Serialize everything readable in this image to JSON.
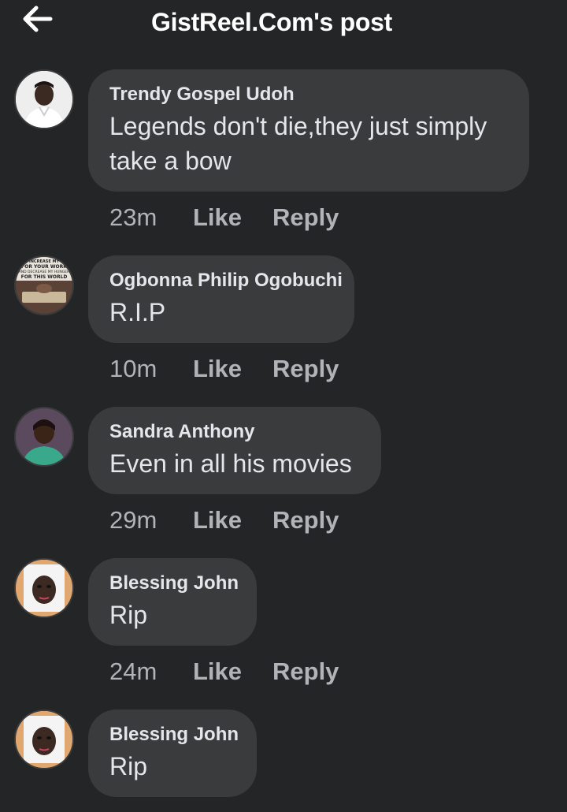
{
  "header": {
    "back_icon": "arrow-left-icon",
    "title": "GistReel.Com's post"
  },
  "comments": [
    {
      "author": "Trendy Gospel Udoh",
      "text": "Legends don't die,they just simply take a bow",
      "time": "23m",
      "like_label": "Like",
      "reply_label": "Reply"
    },
    {
      "author": "Ogbonna Philip Ogobuchi",
      "text": "R.I.P",
      "time": "10m",
      "like_label": "Like",
      "reply_label": "Reply",
      "avatar_text": [
        "INCREASE MY",
        "FOR YOUR WORK",
        "AND DECREASE MY HUNGER",
        "FOR THIS WORLD"
      ]
    },
    {
      "author": "Sandra Anthony",
      "text": "Even in all his movies",
      "time": "29m",
      "like_label": "Like",
      "reply_label": "Reply"
    },
    {
      "author": "Blessing John",
      "text": "Rip",
      "time": "24m",
      "like_label": "Like",
      "reply_label": "Reply"
    },
    {
      "author": "Blessing John",
      "text": "Rip",
      "time": "",
      "like_label": "",
      "reply_label": ""
    }
  ],
  "colors": {
    "background": "#242526",
    "bubble": "#3a3b3c",
    "primary_text": "#e4e6eb",
    "secondary_text": "#b0b3b8"
  }
}
